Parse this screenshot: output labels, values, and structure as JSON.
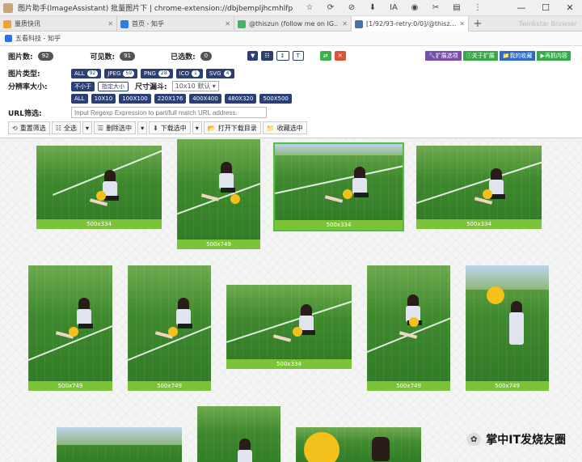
{
  "window": {
    "title": "图片助手(ImageAssistant) 批量图片下 | chrome-extension://dbjbempljhcmhlfpfa...",
    "toolbar_icons": [
      "☆",
      "⟳",
      "⊘",
      "⬇",
      "IA",
      "◉",
      "✂",
      "▤",
      "⋮"
    ],
    "controls": [
      "—",
      "☐",
      "✕"
    ]
  },
  "tabs": [
    {
      "label": "量质快讯",
      "color": "#f0a23a",
      "active": false
    },
    {
      "label": "首页 - 知乎",
      "color": "#2f7be3",
      "active": false
    },
    {
      "label": "@thiszun (follow me on IG...",
      "color": "#4bb06c",
      "active": false
    },
    {
      "label": "[1/92/93-retry:0/0]/@thisz...",
      "color": "#4b6fa8",
      "active": true
    }
  ],
  "tab_add": "+",
  "tab_ghost": "Twinkstar Browser",
  "bookmark": {
    "label": "五看科技 - 知乎"
  },
  "stats": {
    "images_label": "图片数:",
    "images_count": "92",
    "visible_label": "可见数:",
    "visible_count": "91",
    "selected_label": "已选数:",
    "selected_count": "0"
  },
  "top_right_buttons": [
    {
      "label": "扩展选项",
      "color": "#7a4ea8",
      "icon": "🔧"
    },
    {
      "label": "关于扩展",
      "color": "#37a84a",
      "icon": "ⓘ"
    },
    {
      "label": "我的收藏",
      "color": "#2d6bc9",
      "icon": "📁"
    },
    {
      "label": "再抓内容",
      "color": "#37a84a",
      "icon": "▶"
    }
  ],
  "center_icons": {
    "filter": "▼",
    "grid": "☷",
    "sort": "↕",
    "size": "T",
    "swap": "⇄",
    "close": "✕"
  },
  "type_filter": {
    "label": "图片类型:",
    "chips": [
      {
        "label": "ALL",
        "count": "92"
      },
      {
        "label": "JPEG",
        "count": "59"
      },
      {
        "label": "PNG",
        "count": "28"
      },
      {
        "label": "ICO",
        "count": "1"
      },
      {
        "label": "SVG",
        "count": "4"
      }
    ]
  },
  "resolution": {
    "label": "分辨率大小:",
    "min_label": "不小于",
    "fixed_label": "指定大小",
    "size_label": "尺寸漏斗:",
    "size_value": "10x10 默认 ▾"
  },
  "size_presets": [
    "ALL",
    "10X10",
    "100X100",
    "220X176",
    "400X400",
    "480X320",
    "500X500"
  ],
  "url_filter": {
    "label": "URL筛选:",
    "placeholder": "Input Regexp Expression to part/full match URL address."
  },
  "actions": [
    {
      "icon": "⟲",
      "label": "重置筛选"
    },
    {
      "icon": "☷",
      "label": "全选"
    },
    {
      "icon": "▾",
      "label": ""
    },
    {
      "icon": "☰",
      "label": "删除选中"
    },
    {
      "icon": "▾",
      "label": ""
    },
    {
      "icon": "⬇",
      "label": "下载选中"
    },
    {
      "icon": "▾",
      "label": ""
    },
    {
      "icon": "📂",
      "label": "打开下载目录"
    },
    {
      "icon": "📁",
      "label": "收藏选中"
    }
  ],
  "thumbnails": [
    {
      "caption": "500x334"
    },
    {
      "caption": "500x749"
    },
    {
      "caption": "500x334"
    },
    {
      "caption": "500x334"
    },
    {
      "caption": "500x749"
    },
    {
      "caption": "500x749"
    },
    {
      "caption": "500x334"
    },
    {
      "caption": "500x749"
    },
    {
      "caption": "500x749"
    },
    {
      "caption": ""
    },
    {
      "caption": ""
    },
    {
      "caption": ""
    }
  ],
  "watermark": {
    "text": "掌中IT发烧友圈",
    "icon": "✿"
  }
}
